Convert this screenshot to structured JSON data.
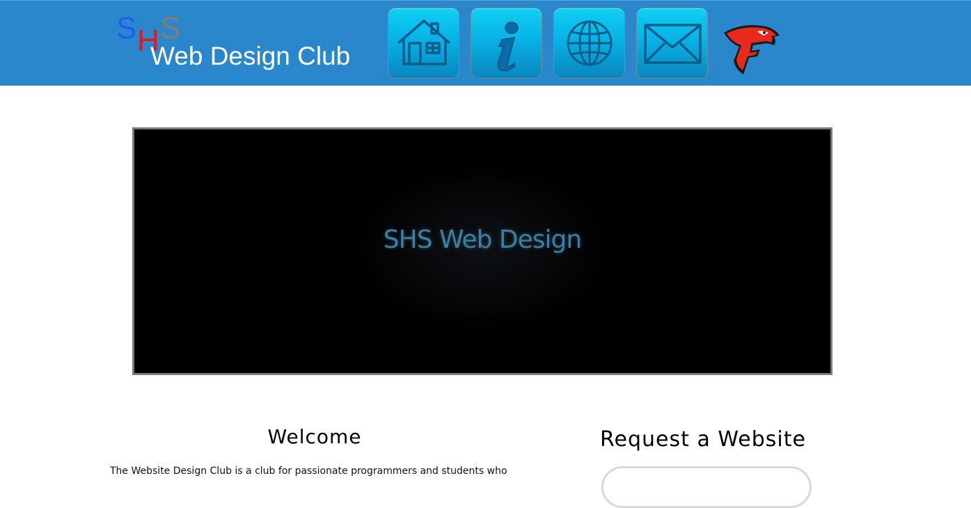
{
  "header": {
    "logo": {
      "letters": [
        "S",
        "H",
        "S"
      ],
      "club_name": "Web Design Club"
    },
    "nav": [
      {
        "icon": "home-icon"
      },
      {
        "icon": "info-icon"
      },
      {
        "icon": "globe-icon"
      },
      {
        "icon": "mail-icon"
      }
    ],
    "mascot_icon": "falcon-logo-icon",
    "colors": {
      "background": "#2a87cc",
      "button": "#07b2e6",
      "letter_s": "#1f5df0",
      "letter_h": "#e8161b",
      "letter_s2": "#8a7a72"
    }
  },
  "banner": {
    "title": "SHS Web Design",
    "text_color": "#3e7ea3"
  },
  "welcome": {
    "title": "Welcome",
    "text": "The Website Design Club is a club for passionate programmers and students who"
  },
  "request": {
    "title": "Request a Website"
  }
}
